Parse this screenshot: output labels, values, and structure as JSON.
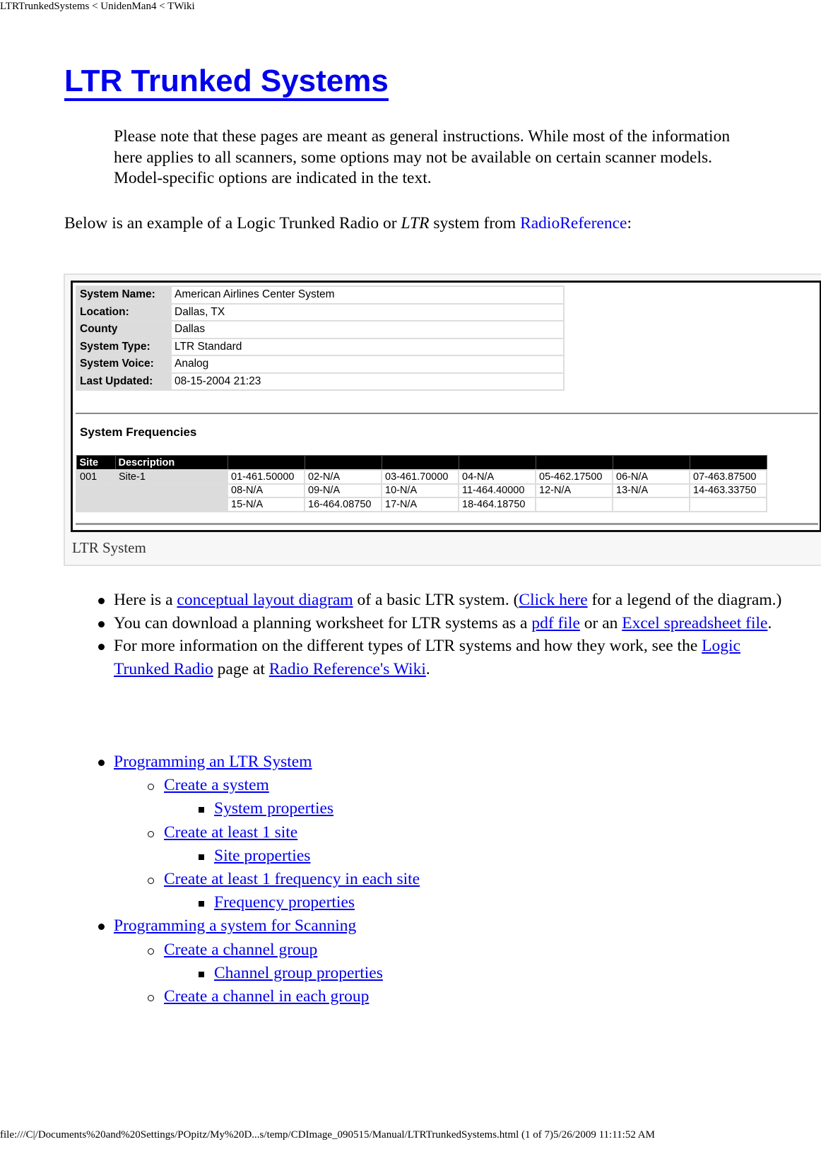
{
  "print_header": "LTRTrunkedSystems < UnidenMan4 < TWiki",
  "print_footer": "file:///C|/Documents%20and%20Settings/POpitz/My%20D...s/temp/CDImage_090515/Manual/LTRTrunkedSystems.html (1 of 7)5/26/2009 11:11:52 AM",
  "title": "LTR Trunked Systems",
  "note": "Please note that these pages are meant as general instructions. While most of the information here applies to all scanners, some options may not be available on certain scanner models. Model-specific options are indicated in the text.",
  "intro": {
    "before": "Below is an example of a Logic Trunked Radio or ",
    "emph": "LTR",
    "middle": " system from ",
    "link": "RadioReference",
    "after": ":"
  },
  "figure": {
    "caption": "LTR System",
    "info_rows": [
      {
        "label": "System Name:",
        "value": "American Airlines Center System"
      },
      {
        "label": "Location:",
        "value": "Dallas, TX"
      },
      {
        "label": "County",
        "value": "Dallas"
      },
      {
        "label": "System Type:",
        "value": "LTR Standard"
      },
      {
        "label": "System Voice:",
        "value": "Analog"
      },
      {
        "label": "Last Updated:",
        "value": "08-15-2004 21:23"
      }
    ],
    "freq_title": "System Frequencies",
    "freq_headers": [
      "Site",
      "Description",
      "",
      "",
      "",
      "",
      "",
      "",
      ""
    ],
    "freq_rows": [
      {
        "site": "001",
        "desc": "Site-1",
        "freqs": [
          "01-461.50000",
          "02-N/A",
          "03-461.70000",
          "04-N/A",
          "05-462.17500",
          "06-N/A",
          "07-463.87500"
        ]
      },
      {
        "site": "",
        "desc": "",
        "freqs": [
          "08-N/A",
          "09-N/A",
          "10-N/A",
          "11-464.40000",
          "12-N/A",
          "13-N/A",
          "14-463.33750"
        ]
      },
      {
        "site": "",
        "desc": "",
        "freqs": [
          "15-N/A",
          "16-464.08750",
          "17-N/A",
          "18-464.18750",
          "",
          "",
          ""
        ]
      }
    ]
  },
  "bullets": [
    {
      "t1": "Here is a ",
      "l1": "conceptual layout diagram",
      "t2": " of a basic LTR system. (",
      "l2": "Click here",
      "t3": " for a legend of the diagram.)"
    },
    {
      "t1": "You can download a planning worksheet for LTR systems as a ",
      "l1": "pdf file",
      "t2": " or an ",
      "l2": "Excel spreadsheet file",
      "t3": "."
    },
    {
      "t1": "For more information on the different types of LTR systems and how they work, see the ",
      "l1": "Logic Trunked Radio",
      "t2": " page at ",
      "l2": "Radio Reference's Wiki",
      "t3": "."
    }
  ],
  "toc": [
    {
      "level": 1,
      "label": "Programming an LTR System"
    },
    {
      "level": 2,
      "label": "Create a system"
    },
    {
      "level": 3,
      "label": "System properties"
    },
    {
      "level": 2,
      "label": "Create at least 1 site"
    },
    {
      "level": 3,
      "label": "Site properties"
    },
    {
      "level": 2,
      "label": "Create at least 1 frequency in each site"
    },
    {
      "level": 3,
      "label": "Frequency properties"
    },
    {
      "level": 1,
      "label": "Programming a system for Scanning"
    },
    {
      "level": 2,
      "label": "Create a channel group"
    },
    {
      "level": 3,
      "label": "Channel group properties"
    },
    {
      "level": 2,
      "label": "Create a channel in each group"
    }
  ]
}
